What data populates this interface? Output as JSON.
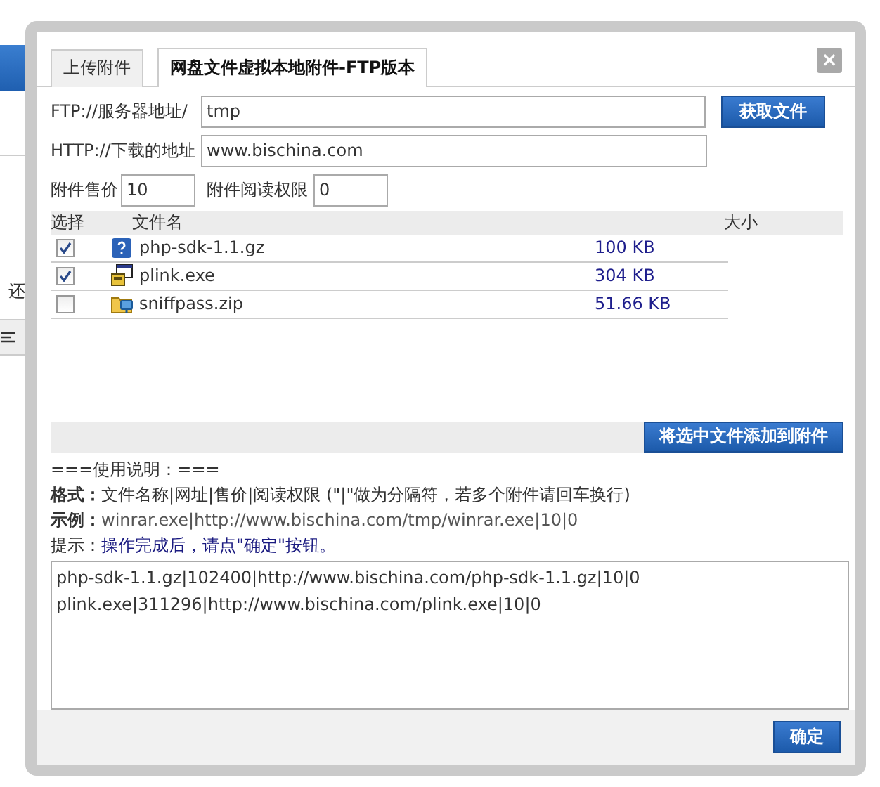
{
  "background": {
    "partial_text": "还"
  },
  "dialog": {
    "tabs": [
      {
        "label": "上传附件",
        "selected": false
      },
      {
        "label": "网盘文件虚拟本地附件-FTP版本",
        "selected": true
      }
    ],
    "close": "×",
    "ftp_label": "FTP://服务器地址/",
    "ftp_value": "tmp",
    "fetch_button": "获取文件",
    "http_label": "HTTP://下载的地址",
    "http_value": "www.bischina.com",
    "price_label": "附件售价",
    "price_value": "10",
    "perm_label": "附件阅读权限",
    "perm_value": "0",
    "table": {
      "columns": [
        "选择",
        "文件名",
        "大小"
      ],
      "rows": [
        {
          "checked": true,
          "kind": "archive",
          "name": "php-sdk-1.1.gz",
          "size": "100 KB"
        },
        {
          "checked": true,
          "kind": "exe",
          "name": "plink.exe",
          "size": "304 KB"
        },
        {
          "checked": false,
          "kind": "zip",
          "name": "sniffpass.zip",
          "size": "51.66 KB"
        }
      ]
    },
    "add_button": "将选中文件添加到附件",
    "help": {
      "title": "===使用说明：===",
      "format_label": "格式：",
      "format_text": "文件名称|网址|售价|阅读权限 (\"|\"做为分隔符，若多个附件请回车换行)",
      "example_label": "示例：",
      "example_text": "winrar.exe|http://www.bischina.com/tmp/winrar.exe|10|0",
      "tip_label": "提示：",
      "tip_text": "操作完成后，请点\"确定\"按钮。"
    },
    "output": "php-sdk-1.1.gz|102400|http://www.bischina.com/php-sdk-1.1.gz|10|0\nplink.exe|311296|http://www.bischina.com/plink.exe|10|0",
    "ok_button": "确定"
  }
}
